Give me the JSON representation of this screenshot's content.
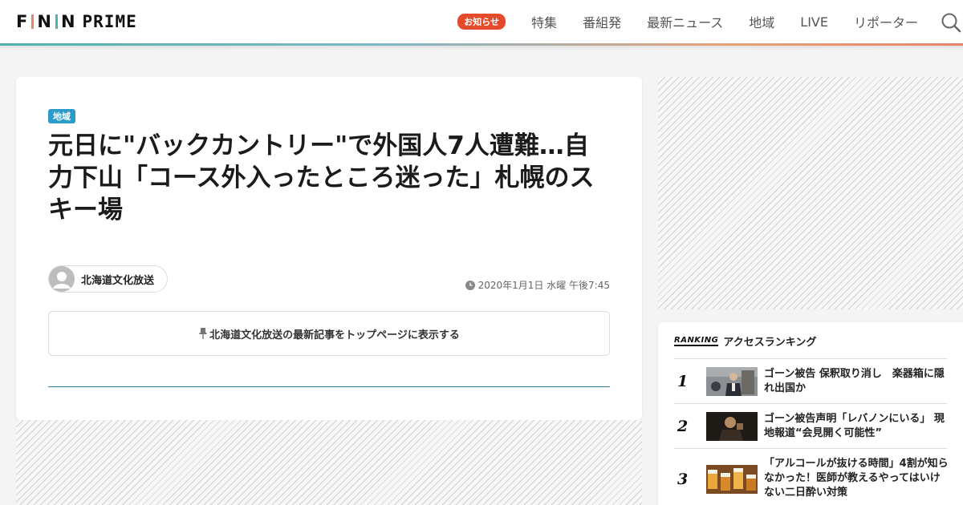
{
  "header": {
    "logo": {
      "fnn": [
        "F",
        "N",
        "N"
      ],
      "prime": "PRIME"
    },
    "notice_badge": "お知らせ",
    "nav": [
      "特集",
      "番組発",
      "最新ニュース",
      "地域",
      "LIVE",
      "リポーター"
    ],
    "search_icon": "search-icon"
  },
  "article": {
    "category": "地域",
    "title": "元日に\"バックカントリー\"で外国人7人遭難…自力下山「コース外入ったところ迷った」札幌のスキー場",
    "author": "北海道文化放送",
    "date": "2020年1月1日 水曜 午後7:45",
    "pin_text": "北海道文化放送の最新記事をトップページに表示する"
  },
  "ranking": {
    "tag": "RANKING",
    "title": "アクセスランキング",
    "items": [
      {
        "rank": "1",
        "text": "ゴーン被告 保釈取り消し　楽器箱に隠れ出国か"
      },
      {
        "rank": "2",
        "text": "ゴーン被告声明「レバノンにいる」 現地報道“会見開く可能性”"
      },
      {
        "rank": "3",
        "text": "「アルコールが抜ける時間」4割が知らなかった！医師が教えるやってはいけない二日酔い対策"
      }
    ]
  },
  "colors": {
    "accent_notice": "#e34b2a",
    "category": "#2c9bc9",
    "logo_bars": [
      "#e9836b",
      "#4fb3a9",
      "#2c9bc9"
    ]
  }
}
